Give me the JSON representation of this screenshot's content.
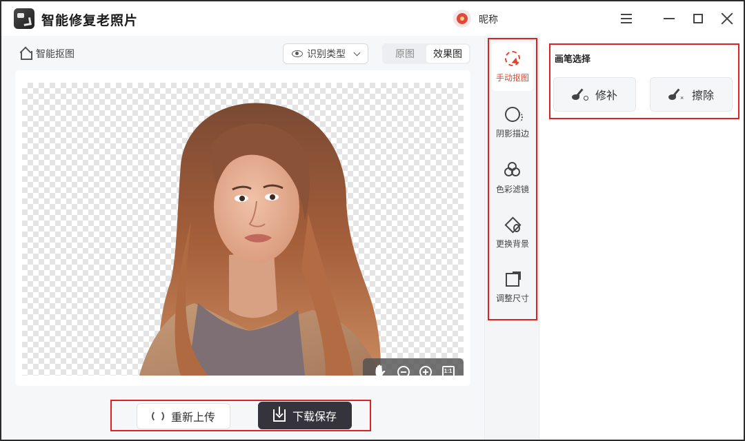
{
  "app": {
    "title": "智能修复老照片",
    "nickname": "昵称"
  },
  "toolbar": {
    "mode_label": "智能抠图",
    "type_select": "识别类型",
    "view_tabs": [
      "原图",
      "效果图"
    ],
    "active_view": "效果图"
  },
  "actions": {
    "reupload": "重新上传",
    "download": "下载保存"
  },
  "tools": [
    {
      "label": "手动抠图",
      "icon": "cursor-cut-icon",
      "active": true
    },
    {
      "label": "阴影描边",
      "icon": "shadow-outline-icon",
      "active": false
    },
    {
      "label": "色彩滤镜",
      "icon": "color-filter-icon",
      "active": false
    },
    {
      "label": "更换背景",
      "icon": "paint-bucket-icon",
      "active": false
    },
    {
      "label": "调整尺寸",
      "icon": "resize-icon",
      "active": false
    }
  ],
  "brush_panel": {
    "title": "画笔选择",
    "repair": "修补",
    "erase": "擦除"
  },
  "colors": {
    "accent": "#e0452d",
    "dark_button": "#35333b",
    "highlight_box": "#e02020"
  }
}
